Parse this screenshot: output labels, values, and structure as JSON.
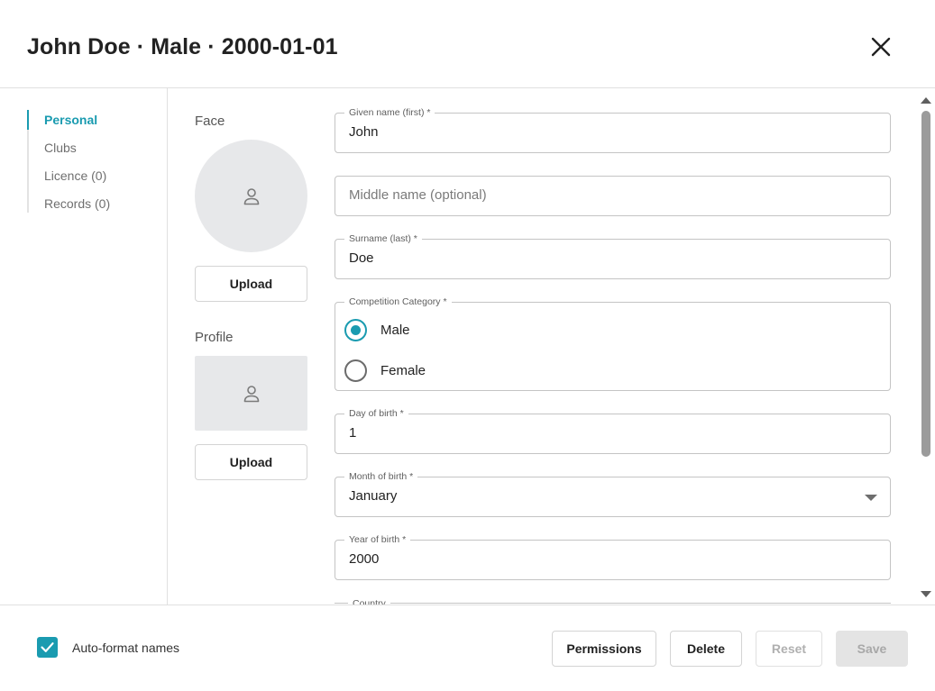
{
  "header": {
    "title": "John Doe · Male · 2000-01-01",
    "close_icon": "close-icon"
  },
  "nav": {
    "items": [
      {
        "label": "Personal",
        "active": true
      },
      {
        "label": "Clubs",
        "active": false
      },
      {
        "label": "Licence (0)",
        "active": false
      },
      {
        "label": "Records (0)",
        "active": false
      }
    ]
  },
  "media": {
    "face_label": "Face",
    "profile_label": "Profile",
    "upload_label": "Upload",
    "placeholder_icon": "person-icon"
  },
  "form": {
    "given_name": {
      "label": "Given name (first) *",
      "value": "John"
    },
    "middle_name": {
      "placeholder": "Middle name (optional)",
      "value": ""
    },
    "surname": {
      "label": "Surname (last) *",
      "value": "Doe"
    },
    "category": {
      "label": "Competition Category  *",
      "options": [
        "Male",
        "Female"
      ],
      "selected": "Male"
    },
    "day_of_birth": {
      "label": "Day of birth *",
      "value": "1"
    },
    "month_of_birth": {
      "label": "Month of birth *",
      "value": "January"
    },
    "year_of_birth": {
      "label": "Year of birth *",
      "value": "2000"
    },
    "country": {
      "label": "Country"
    }
  },
  "footer": {
    "auto_format_label": "Auto-format names",
    "auto_format_checked": true,
    "buttons": {
      "permissions": "Permissions",
      "delete": "Delete",
      "reset": "Reset",
      "save": "Save"
    }
  },
  "colors": {
    "accent": "#1a9bb0"
  }
}
